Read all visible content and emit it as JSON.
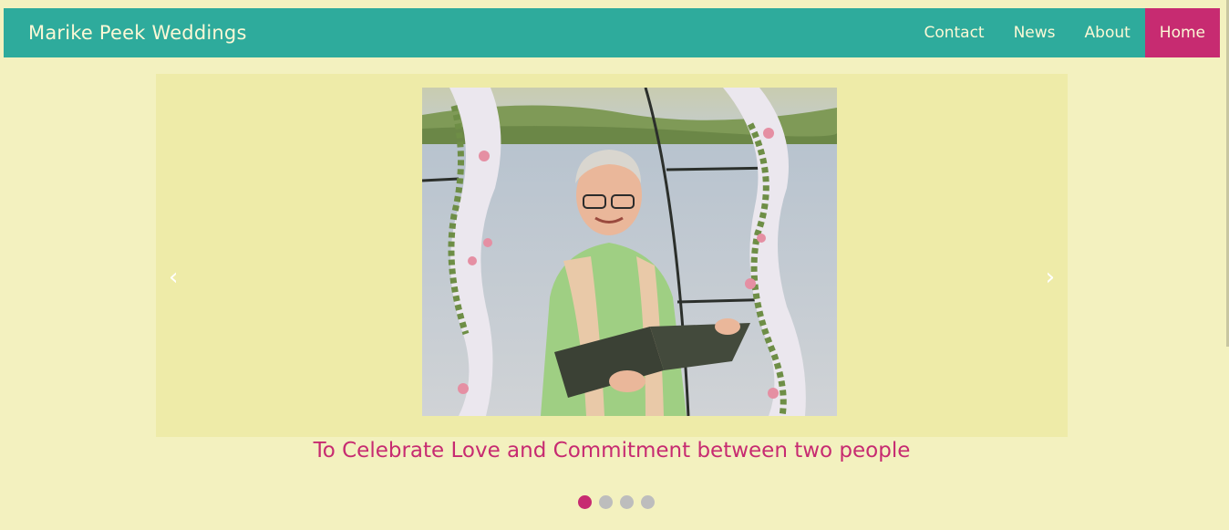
{
  "brand": "Marike Peek Weddings",
  "nav": [
    {
      "label": "Contact",
      "active": false
    },
    {
      "label": "News",
      "active": false
    },
    {
      "label": "About",
      "active": false
    },
    {
      "label": "Home",
      "active": true
    }
  ],
  "carousel": {
    "prev_icon": "‹",
    "next_icon": "›",
    "caption": "To Celebrate Love and Commitment between two people",
    "slide_count": 4,
    "active_slide": 1
  },
  "colors": {
    "page_bg": "#f3f1bf",
    "navbar_bg": "#2eab9c",
    "accent": "#c72b71",
    "carousel_bg": "#eeeba8"
  }
}
